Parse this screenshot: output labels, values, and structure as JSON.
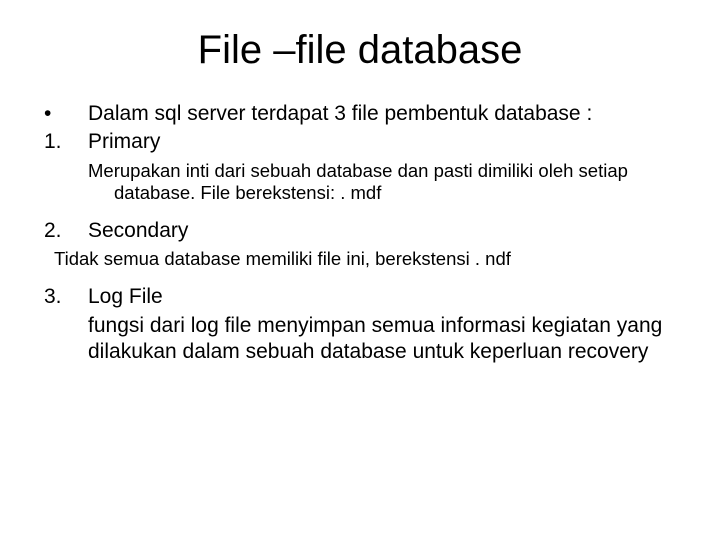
{
  "title": "File –file database",
  "intro": {
    "marker": "•",
    "text": "Dalam sql server terdapat 3 file pembentuk database :"
  },
  "item1": {
    "marker": "1.",
    "label": "Primary",
    "desc": "Merupakan inti dari sebuah database dan pasti dimiliki oleh setiap database. File berekstensi: . mdf"
  },
  "item2": {
    "marker": "2.",
    "label": "Secondary",
    "desc": "Tidak semua database memiliki file ini, berekstensi . ndf"
  },
  "item3": {
    "marker": "3.",
    "label": "Log File",
    "body": "fungsi dari log file menyimpan semua informasi kegiatan yang dilakukan dalam sebuah database untuk keperluan recovery"
  }
}
